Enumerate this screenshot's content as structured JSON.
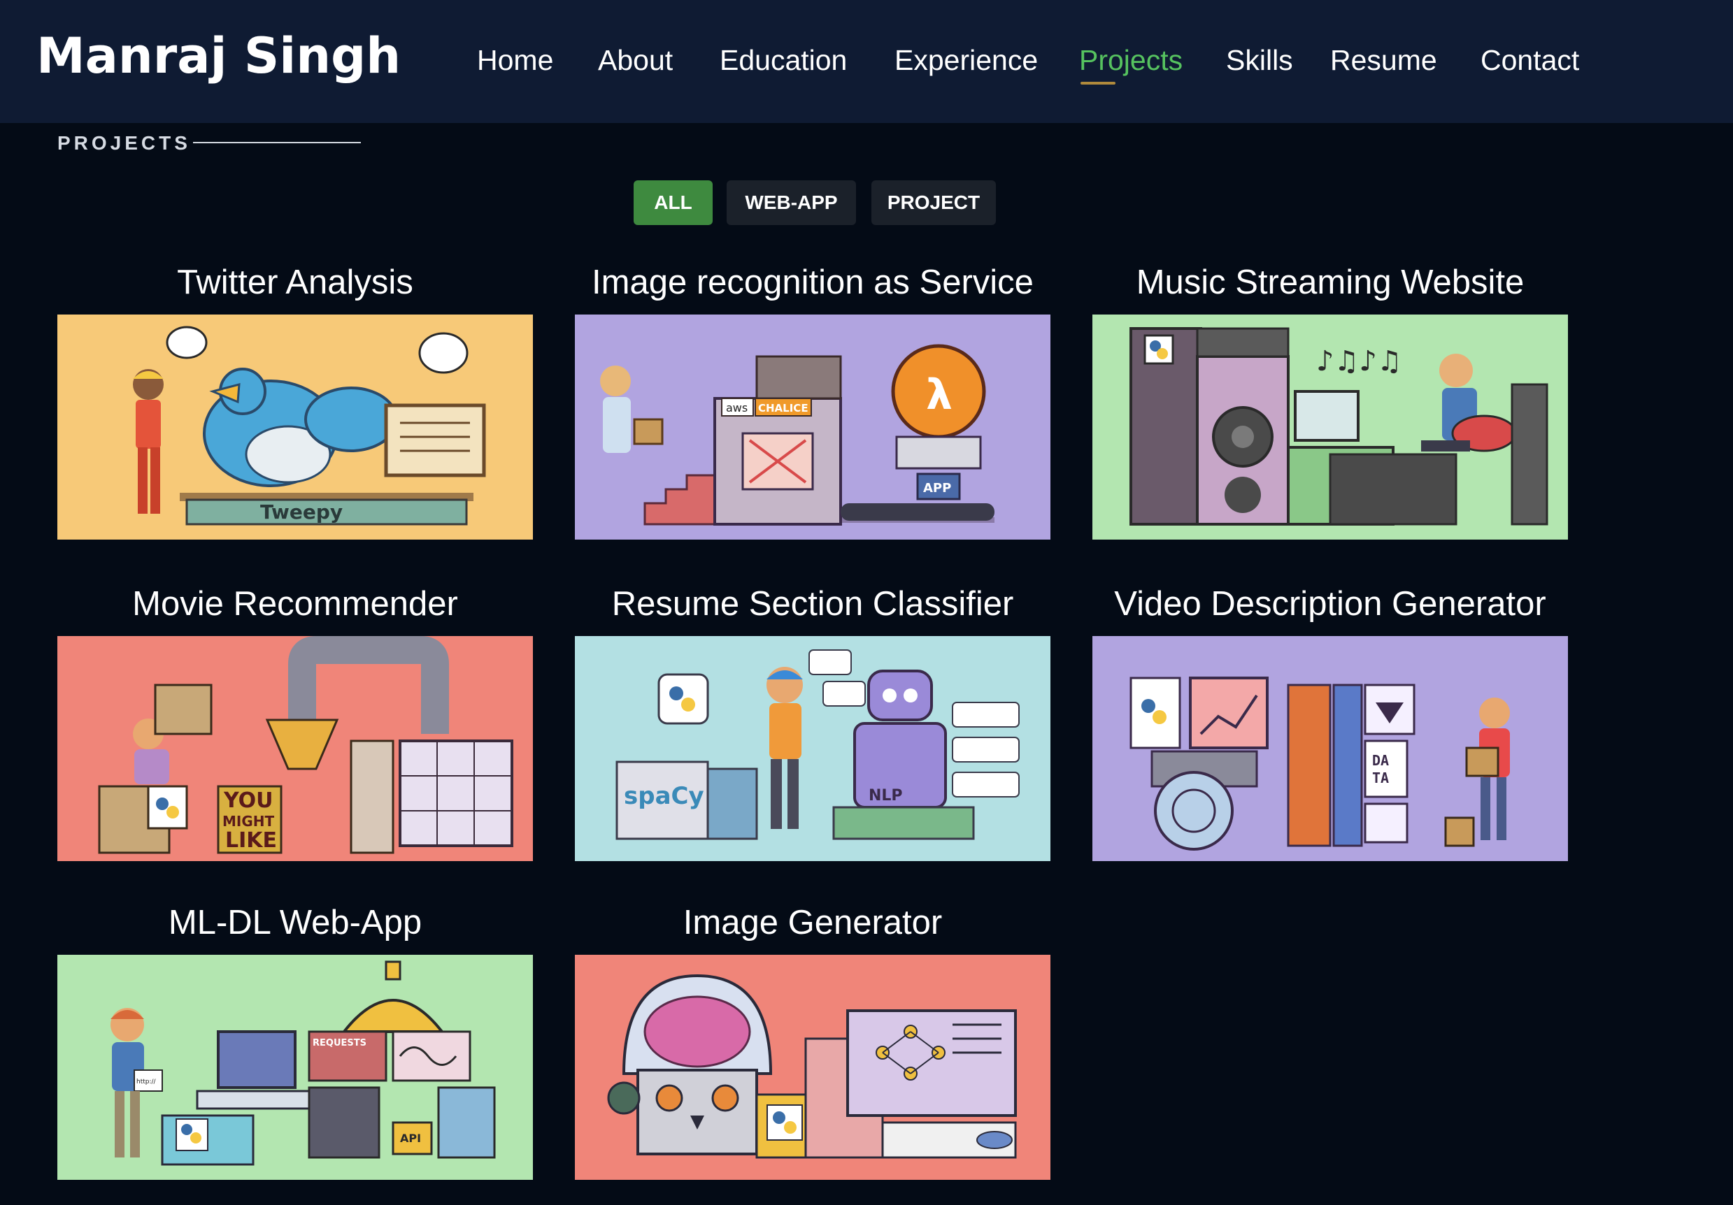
{
  "header": {
    "logo": "Manraj Singh",
    "nav": [
      {
        "label": "Home"
      },
      {
        "label": "About"
      },
      {
        "label": "Education"
      },
      {
        "label": "Experience"
      },
      {
        "label": "Projects",
        "active": true
      },
      {
        "label": "Skills"
      },
      {
        "label": "Resume"
      },
      {
        "label": "Contact"
      }
    ]
  },
  "section": {
    "label": "PROJECTS"
  },
  "filters": [
    {
      "label": "ALL",
      "active": true
    },
    {
      "label": "WEB-APP"
    },
    {
      "label": "PROJECT"
    }
  ],
  "colors": {
    "background": "#040b16",
    "header": "#0f1b33",
    "active_nav": "#56c25f",
    "active_filter": "#3e8a3f",
    "inactive_filter": "#1b212a"
  },
  "projects": [
    {
      "title": "Twitter Analysis",
      "image_bg": "#f7c978",
      "image_text": [
        "Tweepy"
      ],
      "icon": "twitter-bird-illustration"
    },
    {
      "title": "Image recognition as Service",
      "image_bg": "#b1a4e0",
      "image_text": [
        "aws",
        "CHALICE",
        "APP",
        "λ"
      ],
      "icon": "aws-lambda-illustration"
    },
    {
      "title": "Music Streaming Website",
      "image_bg": "#b3e6b0",
      "image_text": [],
      "icon": "music-speakers-illustration"
    },
    {
      "title": "Movie Recommender",
      "image_bg": "#f08579",
      "image_text": [
        "YOU",
        "MIGHT",
        "LIKE"
      ],
      "icon": "movie-machine-illustration"
    },
    {
      "title": "Resume Section Classifier",
      "image_bg": "#b3e0e3",
      "image_text": [
        "spaCy",
        "NLP"
      ],
      "icon": "nlp-robot-illustration"
    },
    {
      "title": "Video Description Generator",
      "image_bg": "#b1a4e0",
      "image_text": [
        "DA",
        "TA"
      ],
      "icon": "video-data-illustration"
    },
    {
      "title": "ML-DL Web-App",
      "image_bg": "#b3e6b0",
      "image_text": [
        "REQUESTS",
        "API",
        "http://"
      ],
      "icon": "web-app-illustration"
    },
    {
      "title": "Image Generator",
      "image_bg": "#f08579",
      "image_text": [],
      "icon": "brain-robot-illustration"
    }
  ]
}
